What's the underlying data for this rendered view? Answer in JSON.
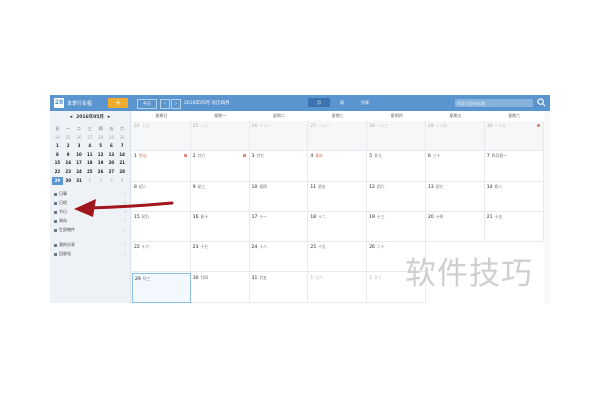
{
  "topbar": {
    "logo": "28",
    "app_name": "本季行车程",
    "add_label": "+",
    "today_label": "今天",
    "prev_icon": "‹",
    "next_icon": "›",
    "current_title": "2016年05月 农历四月",
    "views": [
      "月",
      "周",
      "列表"
    ],
    "search_placeholder": "搜索日程的标题",
    "accent": "#5b95cf",
    "add_color": "#f0ad2d"
  },
  "sidebar": {
    "mini_title": "2016年05月",
    "mini_prev": "◂",
    "mini_next": "▸",
    "weekdays": [
      "日",
      "一",
      "二",
      "三",
      "四",
      "五",
      "六"
    ],
    "days": [
      [
        "24",
        "25",
        "26",
        "27",
        "28",
        "29",
        "30"
      ],
      [
        "1",
        "2",
        "3",
        "4",
        "5",
        "6",
        "7"
      ],
      [
        "8",
        "9",
        "10",
        "11",
        "12",
        "13",
        "14"
      ],
      [
        "15",
        "16",
        "17",
        "18",
        "19",
        "20",
        "21"
      ],
      [
        "22",
        "23",
        "24",
        "25",
        "26",
        "27",
        "28"
      ],
      [
        "29",
        "30",
        "31",
        "1",
        "2",
        "3",
        "4"
      ]
    ],
    "menu": [
      {
        "label": "日事",
        "chev": "›"
      },
      {
        "label": "日程",
        "chev": "›"
      },
      {
        "label": "节日",
        "chev": "›"
      },
      {
        "label": "周向",
        "chev": "›"
      },
      {
        "label": "生辞物件",
        "chev": "⌄"
      },
      {
        "label": "我的分享",
        "chev": "›"
      },
      {
        "label": "回收站",
        "chev": "›"
      }
    ]
  },
  "calendar": {
    "weekdays": [
      "星期日",
      "星期一",
      "星期二",
      "星期三",
      "星期四",
      "星期五",
      "星期六"
    ],
    "rows": [
      [
        {
          "d": "24",
          "l": "十九"
        },
        {
          "d": "25",
          "l": "二十"
        },
        {
          "d": "26",
          "l": "二十一"
        },
        {
          "d": "27",
          "l": "二十二"
        },
        {
          "d": "28",
          "l": "二十三"
        },
        {
          "d": "29",
          "l": "二十四"
        },
        {
          "d": "30",
          "l": "二十五"
        }
      ],
      [
        {
          "d": "1",
          "l": "劳动"
        },
        {
          "d": "2",
          "l": "廿六"
        },
        {
          "d": "3",
          "l": "廿七"
        },
        {
          "d": "4",
          "l": "青年"
        },
        {
          "d": "5",
          "l": "廿九"
        },
        {
          "d": "6",
          "l": "三十"
        },
        {
          "d": "7",
          "l": "四月初一"
        }
      ],
      [
        {
          "d": "8",
          "l": "初二"
        },
        {
          "d": "9",
          "l": "初三"
        },
        {
          "d": "10",
          "l": "初四"
        },
        {
          "d": "11",
          "l": "初五"
        },
        {
          "d": "12",
          "l": "初六"
        },
        {
          "d": "13",
          "l": "初七"
        },
        {
          "d": "14",
          "l": "初八"
        }
      ],
      [
        {
          "d": "15",
          "l": "初九"
        },
        {
          "d": "16",
          "l": "初十"
        },
        {
          "d": "17",
          "l": "十一"
        },
        {
          "d": "18",
          "l": "十二"
        },
        {
          "d": "19",
          "l": "十三"
        },
        {
          "d": "20",
          "l": "十四"
        },
        {
          "d": "21",
          "l": "十五"
        }
      ],
      [
        {
          "d": "22",
          "l": "十六"
        },
        {
          "d": "23",
          "l": "十七"
        },
        {
          "d": "24",
          "l": "十八"
        },
        {
          "d": "25",
          "l": "十九"
        },
        {
          "d": "26",
          "l": "二十"
        }
      ],
      [
        {
          "d": "29",
          "l": "廿三"
        },
        {
          "d": "30",
          "l": "廿四"
        },
        {
          "d": "31",
          "l": "廿五"
        },
        {
          "d": "1",
          "l": "廿六"
        },
        {
          "d": "2",
          "l": "廿七"
        }
      ]
    ]
  },
  "watermark": "软件技巧"
}
